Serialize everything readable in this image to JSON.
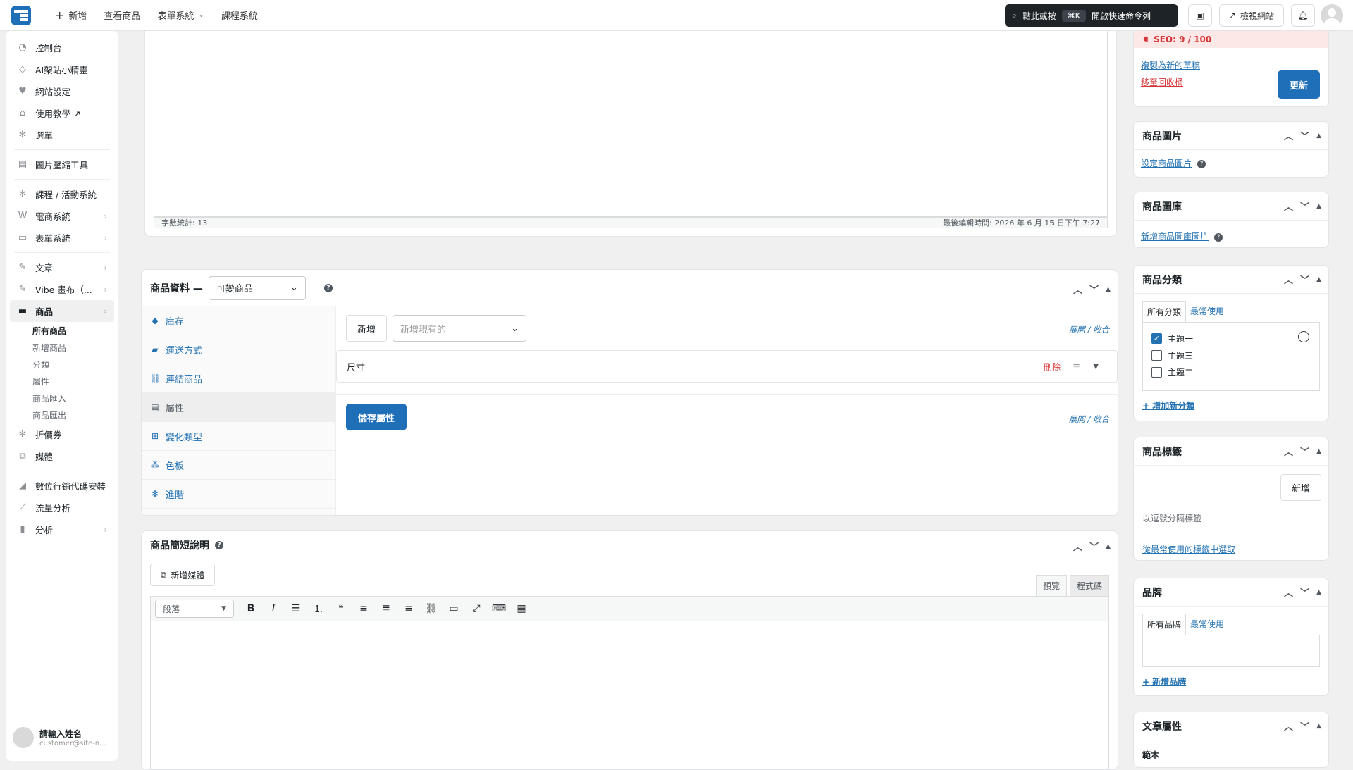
{
  "topbar": {
    "new_label": "新增",
    "view_products": "查看商品",
    "form_system": "表單系統",
    "course_system": "課程系統",
    "cmd_prefix": "點此或按",
    "cmd_key": "⌘K",
    "cmd_suffix": "開啟快速命令列",
    "view_site": "檢視網站"
  },
  "sidebar": {
    "items": [
      {
        "label": "控制台",
        "icon": "dashboard-icon"
      },
      {
        "label": "AI架站小精靈",
        "icon": "diamond-icon"
      },
      {
        "label": "網站設定",
        "icon": "heart-icon"
      },
      {
        "label": "使用教學 ↗",
        "icon": "graduation-icon"
      },
      {
        "label": "選單",
        "icon": "gear-icon"
      }
    ],
    "tools": "圖片壓縮工具",
    "systems": [
      {
        "label": "課程 / 活動系統"
      },
      {
        "label": "電商系統"
      },
      {
        "label": "表單系統"
      }
    ],
    "posts": [
      {
        "label": "文章"
      },
      {
        "label": "Vibe 畫布（..."
      },
      {
        "label": "商品"
      }
    ],
    "product_subs": [
      "所有商品",
      "新增商品",
      "分類",
      "屬性",
      "商品匯入",
      "商品匯出"
    ],
    "more": [
      {
        "label": "折價券"
      },
      {
        "label": "媒體"
      }
    ],
    "marketing": [
      {
        "label": "數位行銷代碼安裝"
      },
      {
        "label": "流量分析"
      },
      {
        "label": "分析"
      }
    ],
    "profile": {
      "name": "請輸入姓名",
      "email": "customer@site-n..."
    }
  },
  "editor": {
    "word_count": "字數統計: 13",
    "last_edit": "最後編輯時間: 2026 年 6 月 15 日下午 7:27"
  },
  "product_data": {
    "title": "商品資料 —",
    "type": "可變商品",
    "tabs": [
      "庫存",
      "運送方式",
      "連結商品",
      "屬性",
      "變化類型",
      "色板",
      "進階"
    ],
    "add_button": "新增",
    "add_existing_placeholder": "新增現有的",
    "expand": "展開",
    "collapse": "收合",
    "attr_name": "尺寸",
    "delete": "刪除",
    "save_attrs": "儲存屬性"
  },
  "short_desc": {
    "title": "商品簡短說明",
    "add_media": "新增媒體",
    "preview": "預覽",
    "code": "程式碼",
    "format": "段落"
  },
  "right": {
    "seo": "SEO: 9 / 100",
    "copy_draft": "複製為新的草稿",
    "trash": "移至回收桶",
    "update": "更新",
    "image": {
      "title": "商品圖片",
      "link": "設定商品圖片"
    },
    "gallery": {
      "title": "商品圖庫",
      "link": "新增商品圖庫圖片"
    },
    "category": {
      "title": "商品分類",
      "tab_all": "所有分類",
      "tab_common": "最常使用",
      "items": [
        "主題一",
        "主題三",
        "主題二"
      ],
      "add": "+ 增加新分類"
    },
    "tags": {
      "title": "商品標籤",
      "add": "新增",
      "hint": "以逗號分隔標籤",
      "choose": "從最常使用的標籤中選取"
    },
    "brand": {
      "title": "品牌",
      "tab_all": "所有品牌",
      "tab_common": "最常使用",
      "add": "+ 新增品牌"
    },
    "post_attr": {
      "title": "文章屬性",
      "template": "範本"
    }
  }
}
